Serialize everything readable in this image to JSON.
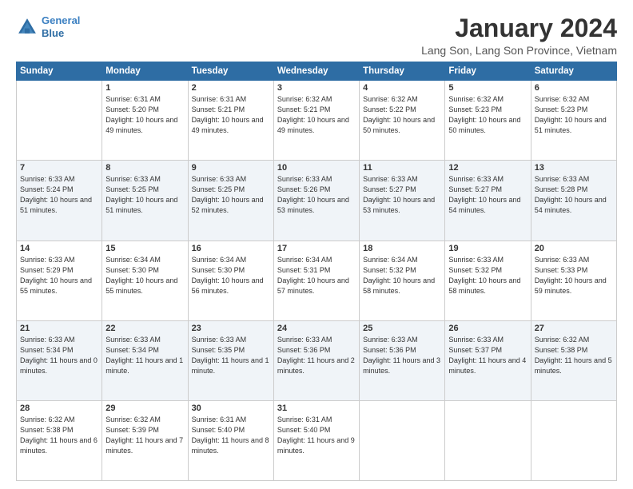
{
  "app": {
    "logo_line1": "General",
    "logo_line2": "Blue"
  },
  "header": {
    "month": "January 2024",
    "location": "Lang Son, Lang Son Province, Vietnam"
  },
  "days_of_week": [
    "Sunday",
    "Monday",
    "Tuesday",
    "Wednesday",
    "Thursday",
    "Friday",
    "Saturday"
  ],
  "weeks": [
    [
      {
        "day": "",
        "sunrise": "",
        "sunset": "",
        "daylight": ""
      },
      {
        "day": "1",
        "sunrise": "Sunrise: 6:31 AM",
        "sunset": "Sunset: 5:20 PM",
        "daylight": "Daylight: 10 hours and 49 minutes."
      },
      {
        "day": "2",
        "sunrise": "Sunrise: 6:31 AM",
        "sunset": "Sunset: 5:21 PM",
        "daylight": "Daylight: 10 hours and 49 minutes."
      },
      {
        "day": "3",
        "sunrise": "Sunrise: 6:32 AM",
        "sunset": "Sunset: 5:21 PM",
        "daylight": "Daylight: 10 hours and 49 minutes."
      },
      {
        "day": "4",
        "sunrise": "Sunrise: 6:32 AM",
        "sunset": "Sunset: 5:22 PM",
        "daylight": "Daylight: 10 hours and 50 minutes."
      },
      {
        "day": "5",
        "sunrise": "Sunrise: 6:32 AM",
        "sunset": "Sunset: 5:23 PM",
        "daylight": "Daylight: 10 hours and 50 minutes."
      },
      {
        "day": "6",
        "sunrise": "Sunrise: 6:32 AM",
        "sunset": "Sunset: 5:23 PM",
        "daylight": "Daylight: 10 hours and 51 minutes."
      }
    ],
    [
      {
        "day": "7",
        "sunrise": "Sunrise: 6:33 AM",
        "sunset": "Sunset: 5:24 PM",
        "daylight": "Daylight: 10 hours and 51 minutes."
      },
      {
        "day": "8",
        "sunrise": "Sunrise: 6:33 AM",
        "sunset": "Sunset: 5:25 PM",
        "daylight": "Daylight: 10 hours and 51 minutes."
      },
      {
        "day": "9",
        "sunrise": "Sunrise: 6:33 AM",
        "sunset": "Sunset: 5:25 PM",
        "daylight": "Daylight: 10 hours and 52 minutes."
      },
      {
        "day": "10",
        "sunrise": "Sunrise: 6:33 AM",
        "sunset": "Sunset: 5:26 PM",
        "daylight": "Daylight: 10 hours and 53 minutes."
      },
      {
        "day": "11",
        "sunrise": "Sunrise: 6:33 AM",
        "sunset": "Sunset: 5:27 PM",
        "daylight": "Daylight: 10 hours and 53 minutes."
      },
      {
        "day": "12",
        "sunrise": "Sunrise: 6:33 AM",
        "sunset": "Sunset: 5:27 PM",
        "daylight": "Daylight: 10 hours and 54 minutes."
      },
      {
        "day": "13",
        "sunrise": "Sunrise: 6:33 AM",
        "sunset": "Sunset: 5:28 PM",
        "daylight": "Daylight: 10 hours and 54 minutes."
      }
    ],
    [
      {
        "day": "14",
        "sunrise": "Sunrise: 6:33 AM",
        "sunset": "Sunset: 5:29 PM",
        "daylight": "Daylight: 10 hours and 55 minutes."
      },
      {
        "day": "15",
        "sunrise": "Sunrise: 6:34 AM",
        "sunset": "Sunset: 5:30 PM",
        "daylight": "Daylight: 10 hours and 55 minutes."
      },
      {
        "day": "16",
        "sunrise": "Sunrise: 6:34 AM",
        "sunset": "Sunset: 5:30 PM",
        "daylight": "Daylight: 10 hours and 56 minutes."
      },
      {
        "day": "17",
        "sunrise": "Sunrise: 6:34 AM",
        "sunset": "Sunset: 5:31 PM",
        "daylight": "Daylight: 10 hours and 57 minutes."
      },
      {
        "day": "18",
        "sunrise": "Sunrise: 6:34 AM",
        "sunset": "Sunset: 5:32 PM",
        "daylight": "Daylight: 10 hours and 58 minutes."
      },
      {
        "day": "19",
        "sunrise": "Sunrise: 6:33 AM",
        "sunset": "Sunset: 5:32 PM",
        "daylight": "Daylight: 10 hours and 58 minutes."
      },
      {
        "day": "20",
        "sunrise": "Sunrise: 6:33 AM",
        "sunset": "Sunset: 5:33 PM",
        "daylight": "Daylight: 10 hours and 59 minutes."
      }
    ],
    [
      {
        "day": "21",
        "sunrise": "Sunrise: 6:33 AM",
        "sunset": "Sunset: 5:34 PM",
        "daylight": "Daylight: 11 hours and 0 minutes."
      },
      {
        "day": "22",
        "sunrise": "Sunrise: 6:33 AM",
        "sunset": "Sunset: 5:34 PM",
        "daylight": "Daylight: 11 hours and 1 minute."
      },
      {
        "day": "23",
        "sunrise": "Sunrise: 6:33 AM",
        "sunset": "Sunset: 5:35 PM",
        "daylight": "Daylight: 11 hours and 1 minute."
      },
      {
        "day": "24",
        "sunrise": "Sunrise: 6:33 AM",
        "sunset": "Sunset: 5:36 PM",
        "daylight": "Daylight: 11 hours and 2 minutes."
      },
      {
        "day": "25",
        "sunrise": "Sunrise: 6:33 AM",
        "sunset": "Sunset: 5:36 PM",
        "daylight": "Daylight: 11 hours and 3 minutes."
      },
      {
        "day": "26",
        "sunrise": "Sunrise: 6:33 AM",
        "sunset": "Sunset: 5:37 PM",
        "daylight": "Daylight: 11 hours and 4 minutes."
      },
      {
        "day": "27",
        "sunrise": "Sunrise: 6:32 AM",
        "sunset": "Sunset: 5:38 PM",
        "daylight": "Daylight: 11 hours and 5 minutes."
      }
    ],
    [
      {
        "day": "28",
        "sunrise": "Sunrise: 6:32 AM",
        "sunset": "Sunset: 5:38 PM",
        "daylight": "Daylight: 11 hours and 6 minutes."
      },
      {
        "day": "29",
        "sunrise": "Sunrise: 6:32 AM",
        "sunset": "Sunset: 5:39 PM",
        "daylight": "Daylight: 11 hours and 7 minutes."
      },
      {
        "day": "30",
        "sunrise": "Sunrise: 6:31 AM",
        "sunset": "Sunset: 5:40 PM",
        "daylight": "Daylight: 11 hours and 8 minutes."
      },
      {
        "day": "31",
        "sunrise": "Sunrise: 6:31 AM",
        "sunset": "Sunset: 5:40 PM",
        "daylight": "Daylight: 11 hours and 9 minutes."
      },
      {
        "day": "",
        "sunrise": "",
        "sunset": "",
        "daylight": ""
      },
      {
        "day": "",
        "sunrise": "",
        "sunset": "",
        "daylight": ""
      },
      {
        "day": "",
        "sunrise": "",
        "sunset": "",
        "daylight": ""
      }
    ]
  ]
}
